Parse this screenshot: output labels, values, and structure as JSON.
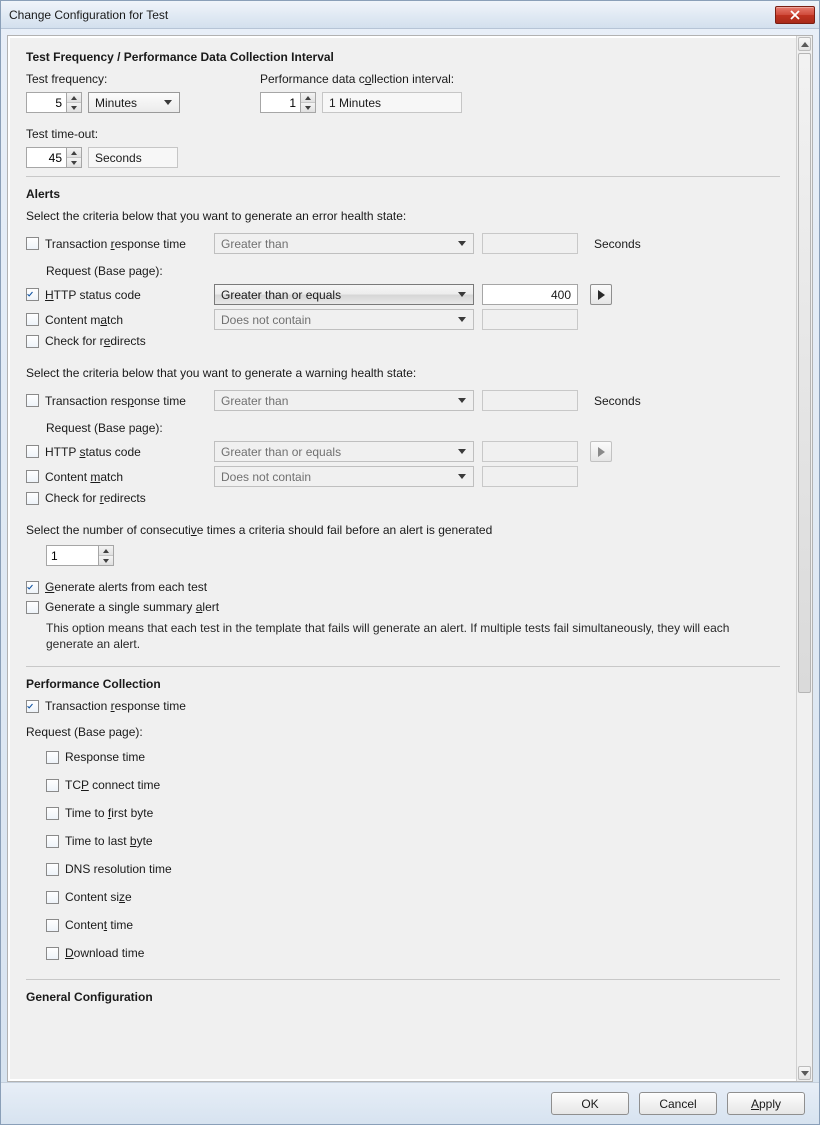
{
  "window": {
    "title": "Change Configuration for Test"
  },
  "sections": {
    "freq": "Test Frequency / Performance Data Collection Interval",
    "alerts": "Alerts",
    "perf": "Performance Collection",
    "general": "General Configuration"
  },
  "freq": {
    "test_freq_label": "Test frequency:",
    "test_freq_value": "5",
    "test_freq_unit": "Minutes",
    "pdci_label": "Performance data collection interval:",
    "pdci_value": "1",
    "pdci_display": "1 Minutes",
    "timeout_label": "Test time-out:",
    "timeout_value": "45",
    "timeout_unit": "Seconds"
  },
  "alerts": {
    "err_intro": "Select the criteria below that you want to generate an error health state:",
    "warn_intro": "Select the criteria below that you want to generate a warning health state:",
    "trt_label": "Transaction response time",
    "trt_op": "Greater than",
    "seconds": "Seconds",
    "req_base": "Request (Base page):",
    "http_label": "HTTP status code",
    "http_op": "Greater than or equals",
    "http_val": "400",
    "content_label": "Content match",
    "content_op": "Does not contain",
    "redirect_label": "Check for redirects",
    "consec_label": "Select the number of consecutive times a criteria should fail before an alert is generated",
    "consec_value": "1",
    "gen_each": "Generate alerts from each test",
    "gen_single": "Generate a single summary alert",
    "gen_desc": "This option means that each test in the template that fails will generate an alert. If multiple tests fail simultaneously, they will each generate an alert."
  },
  "perf": {
    "trt": "Transaction response time",
    "req_base": "Request (Base page):",
    "items": {
      "resp": "Response time",
      "tcp": "TCP connect time",
      "ttfb": "Time to first byte",
      "ttlb": "Time to last byte",
      "dns": "DNS resolution time",
      "csize": "Content size",
      "ctime": "Content time",
      "dl": "Download time"
    }
  },
  "buttons": {
    "ok": "OK",
    "cancel": "Cancel",
    "apply": "Apply"
  }
}
